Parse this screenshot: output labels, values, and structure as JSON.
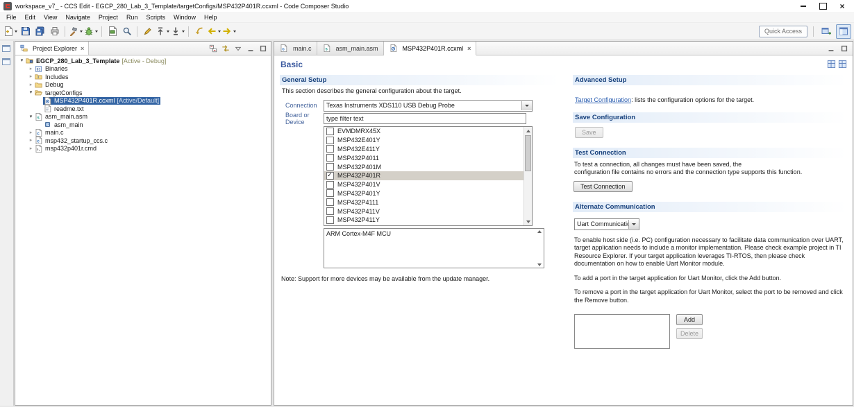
{
  "window": {
    "title": "workspace_v7_ - CCS Edit - EGCP_280_Lab_3_Template/targetConfigs/MSP432P401R.ccxml - Code Composer Studio",
    "menus": [
      "File",
      "Edit",
      "View",
      "Navigate",
      "Project",
      "Run",
      "Scripts",
      "Window",
      "Help"
    ],
    "quick_access_label": "Quick Access"
  },
  "toolbar": {
    "groups": [
      [
        {
          "name": "new-file",
          "dropdown": true
        },
        {
          "name": "save"
        },
        {
          "name": "save-all"
        },
        {
          "name": "print"
        }
      ],
      [
        {
          "name": "build",
          "dropdown": true
        },
        {
          "name": "debug",
          "dropdown": true
        }
      ],
      [
        {
          "name": "new-target-configuration"
        },
        {
          "name": "search"
        }
      ],
      [
        {
          "name": "mark-occurrences"
        },
        {
          "name": "previous-annotation",
          "dropdown": true
        },
        {
          "name": "next-annotation",
          "dropdown": true
        }
      ],
      [
        {
          "name": "last-edit-location"
        },
        {
          "name": "back",
          "dropdown": true
        },
        {
          "name": "forward",
          "dropdown": true
        }
      ]
    ]
  },
  "project_explorer": {
    "title": "Project Explorer",
    "tree": [
      {
        "label": "EGCP_280_Lab_3_Template",
        "suffix": "[Active - Debug]",
        "level": 0,
        "arrow": "expanded",
        "icon": "project",
        "bold": true
      },
      {
        "label": "Binaries",
        "level": 1,
        "arrow": "collapsed",
        "icon": "binaries"
      },
      {
        "label": "Includes",
        "level": 1,
        "arrow": "collapsed",
        "icon": "includes"
      },
      {
        "label": "Debug",
        "level": 1,
        "arrow": "collapsed",
        "icon": "folder"
      },
      {
        "label": "targetConfigs",
        "level": 1,
        "arrow": "expanded",
        "icon": "folder-open"
      },
      {
        "label": "MSP432P401R.ccxml",
        "suffix": "[Active/Default]",
        "level": 2,
        "arrow": null,
        "icon": "ccxml",
        "selected": true
      },
      {
        "label": "readme.txt",
        "level": 2,
        "arrow": null,
        "icon": "text"
      },
      {
        "label": "asm_main.asm",
        "level": 1,
        "arrow": "expanded",
        "icon": "asm"
      },
      {
        "label": "asm_main",
        "level": 2,
        "arrow": null,
        "icon": "symbol"
      },
      {
        "label": "main.c",
        "level": 1,
        "arrow": "collapsed",
        "icon": "c"
      },
      {
        "label": "msp432_startup_ccs.c",
        "level": 1,
        "arrow": "collapsed",
        "icon": "c"
      },
      {
        "label": "msp432p401r.cmd",
        "level": 1,
        "arrow": "collapsed",
        "icon": "cmd"
      }
    ]
  },
  "editor": {
    "tabs": [
      {
        "label": "main.c",
        "icon": "c",
        "active": false
      },
      {
        "label": "asm_main.asm",
        "icon": "asm",
        "active": false
      },
      {
        "label": "MSP432P401R.ccxml",
        "icon": "ccxml",
        "active": true
      }
    ],
    "form": {
      "title": "Basic",
      "general_setup": {
        "title": "General Setup",
        "description": "This section describes the general configuration about the target.",
        "connection_label": "Connection",
        "connection_value": "Texas Instruments XDS110 USB Debug Probe",
        "board_label": "Board or Device",
        "board_filter": "type filter text",
        "devices": [
          {
            "label": "EVMDMRX45X",
            "checked": false
          },
          {
            "label": "MSP432E401Y",
            "checked": false
          },
          {
            "label": "MSP432E411Y",
            "checked": false
          },
          {
            "label": "MSP432P4011",
            "checked": false
          },
          {
            "label": "MSP432P401M",
            "checked": false
          },
          {
            "label": "MSP432P401R",
            "checked": true
          },
          {
            "label": "MSP432P401V",
            "checked": false
          },
          {
            "label": "MSP432P401Y",
            "checked": false
          },
          {
            "label": "MSP432P4111",
            "checked": false
          },
          {
            "label": "MSP432P411V",
            "checked": false
          },
          {
            "label": "MSP432P411Y",
            "checked": false
          }
        ],
        "device_description": "ARM Cortex-M4F MCU",
        "note": "Note: Support for more devices may be available from the update manager."
      },
      "advanced_setup": {
        "title": "Advanced Setup",
        "link": "Target Configuration",
        "link_suffix": ": lists the configuration options for the target."
      },
      "save_configuration": {
        "title": "Save Configuration",
        "save_button": "Save"
      },
      "test_connection": {
        "title": "Test Connection",
        "description": "To test a connection, all changes must have been saved, the\nconfiguration file contains no errors and the connection type supports this function.",
        "button": "Test Connection"
      },
      "alternate_communication": {
        "title": "Alternate Communication",
        "dropdown_value": "Uart Communication",
        "para1": "To enable host side (i.e. PC) configuration necessary to facilitate data communication over UART, target application needs to include a monitor implementation. Please check example project in TI Resource Explorer. If your target application leverages TI-RTOS, then please check documentation on how to enable Uart Monitor module.",
        "para2": "To add a port in the target application for Uart Monitor, click the Add button.",
        "para3": "To remove a port in the target application for Uart Monitor, select the port to be removed and click the Remove button.",
        "add_button": "Add",
        "delete_button": "Delete"
      }
    }
  }
}
